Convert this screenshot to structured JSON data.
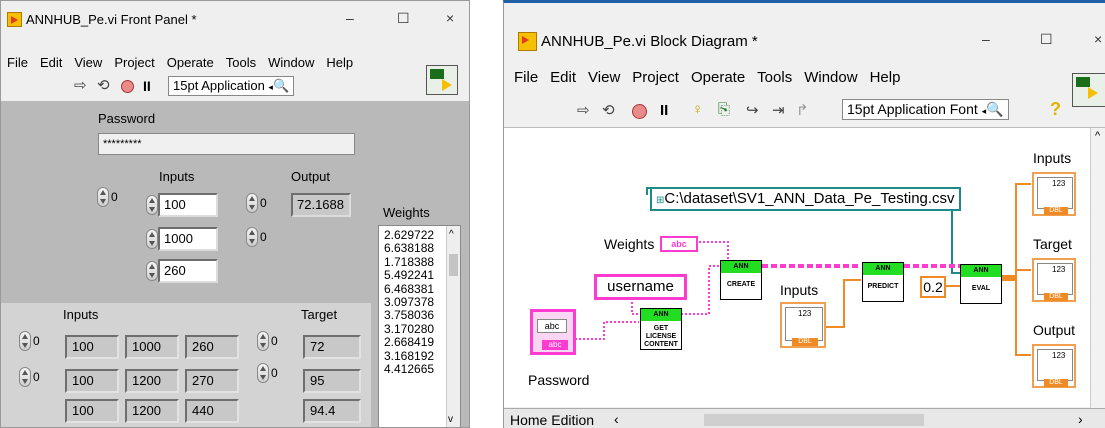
{
  "front_panel": {
    "title": "ANNHUB_Pe.vi Front Panel *",
    "window_buttons": {
      "minimize": "–",
      "maximize": "☐",
      "close": "×"
    },
    "menu": [
      "File",
      "Edit",
      "View",
      "Project",
      "Operate",
      "Tools",
      "Window",
      "Help"
    ],
    "font_selector": "15pt Application",
    "password": {
      "label": "Password",
      "value": "*********"
    },
    "inputs_control": {
      "label": "Inputs",
      "index": "0",
      "values": [
        "100",
        "1000",
        "260"
      ]
    },
    "output_indicator": {
      "label": "Output",
      "index": "0",
      "value": "72.1688",
      "index2": "0"
    },
    "weights": {
      "label": "Weights",
      "values": [
        "2.629722",
        "6.638188",
        "1.718388",
        "5.492241",
        "6.468381",
        "3.097378",
        "3.758036",
        "3.170280",
        "2.668419",
        "3.168192",
        "4.412665"
      ]
    },
    "inputs_array": {
      "label": "Inputs",
      "row_indices": [
        "0",
        "0"
      ],
      "rows": [
        [
          "100",
          "1000",
          "260"
        ],
        [
          "100",
          "1200",
          "270"
        ],
        [
          "100",
          "1200",
          "440"
        ]
      ]
    },
    "target_array": {
      "label": "Target",
      "row_indices": [
        "0",
        "0"
      ],
      "values": [
        "72",
        "95",
        "94.4"
      ]
    }
  },
  "block_diagram": {
    "title": "ANNHUB_Pe.vi Block Diagram *",
    "window_buttons": {
      "minimize": "–",
      "maximize": "☐",
      "close": "×"
    },
    "menu": [
      "File",
      "Edit",
      "View",
      "Project",
      "Operate",
      "Tools",
      "Window",
      "Help"
    ],
    "font_selector": "15pt Application Font",
    "path_constant": "C:\\dataset\\SV1_ANN_Data_Pe_Testing.csv",
    "weights_label": "Weights",
    "username_constant": "username",
    "password_label": "Password",
    "string_tag": "abc",
    "inputs_label": "Inputs",
    "numeric_constant": "0.2",
    "subvis": {
      "create": {
        "header": "ANN",
        "body": "CREATE"
      },
      "license": {
        "header": "ANN",
        "body": "GET LICENSE CONTENT"
      },
      "predict": {
        "header": "ANN",
        "body": "PREDICT"
      },
      "eval": {
        "header": "ANN",
        "body": "EVAL"
      }
    },
    "right_terminals": [
      "Inputs",
      "Target",
      "Output"
    ],
    "terminal_tag": "123",
    "dbl_tag": "DBL",
    "status_bar": "Home Edition"
  },
  "colors": {
    "panel_grey": "#b9b9b9",
    "frame_grey": "#d9d9d9",
    "string_wire": "#ff3bd0",
    "numeric_wire": "#f08a24",
    "path_wire": "#1f8a8a",
    "subvi_header": "#22dd22"
  }
}
